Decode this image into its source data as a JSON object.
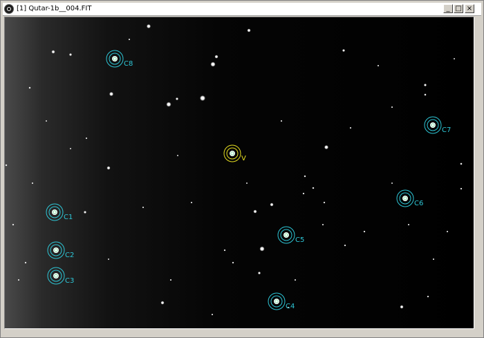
{
  "window": {
    "title": "[1] Qutar-1b__004.FIT",
    "minimize_glyph": "_",
    "maximize_glyph": "□",
    "close_glyph": "×"
  },
  "colors": {
    "comparison_marker": "#2ec8d8",
    "variable_marker": "#e8e020",
    "sky_background": "#000000"
  },
  "markers": [
    {
      "label": "C8",
      "type": "comparison"
    },
    {
      "label": "V",
      "type": "variable"
    },
    {
      "label": "C7",
      "type": "comparison"
    },
    {
      "label": "C6",
      "type": "comparison"
    },
    {
      "label": "C1",
      "type": "comparison"
    },
    {
      "label": "C5",
      "type": "comparison"
    },
    {
      "label": "C2",
      "type": "comparison"
    },
    {
      "label": "C3",
      "type": "comparison"
    },
    {
      "label": "C4",
      "type": "comparison"
    }
  ]
}
